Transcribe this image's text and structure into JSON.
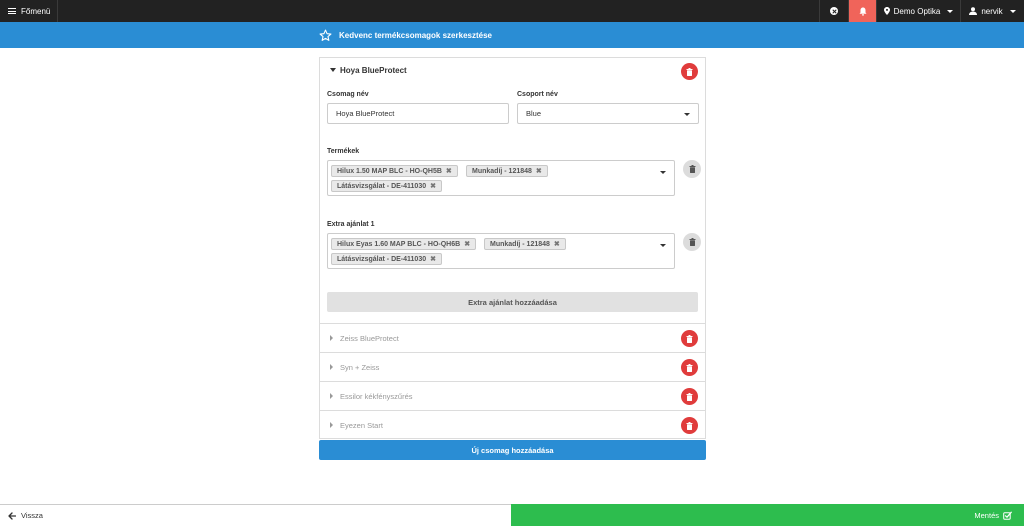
{
  "topbar": {
    "menu_label": "Főmenü",
    "location": "Demo Optika",
    "user": "nervik"
  },
  "header": {
    "title": "Kedvenc termékcsomagok szerkesztése"
  },
  "package": {
    "name": "Hoya BlueProtect",
    "name_label": "Csomag név",
    "name_value": "Hoya BlueProtect",
    "group_label": "Csoport név",
    "group_value": "Blue",
    "products_label": "Termékek",
    "products": [
      "Hilux 1.50 MAP BLC - HO-QH5B",
      "Munkadíj - 121848",
      "Látásvizsgálat - DE-411030"
    ],
    "extra_label": "Extra ajánlat 1",
    "extra_products": [
      "Hilux Eyas 1.60 MAP BLC - HO-QH6B",
      "Munkadíj - 121848",
      "Látásvizsgálat - DE-411030"
    ],
    "add_extra_label": "Extra ajánlat hozzáadása"
  },
  "collapsed_packages": [
    "Zeiss BlueProtect",
    "Syn + Zeiss",
    "Essilor kékfényszűrés",
    "Eyezen Start"
  ],
  "new_package_label": "Új csomag hozzáadása",
  "footer": {
    "back_label": "Vissza",
    "save_label": "Mentés"
  },
  "colors": {
    "accent": "#2a8dd4",
    "danger": "#e03c3c",
    "success": "#2dbd4e",
    "bell": "#f0645a"
  }
}
